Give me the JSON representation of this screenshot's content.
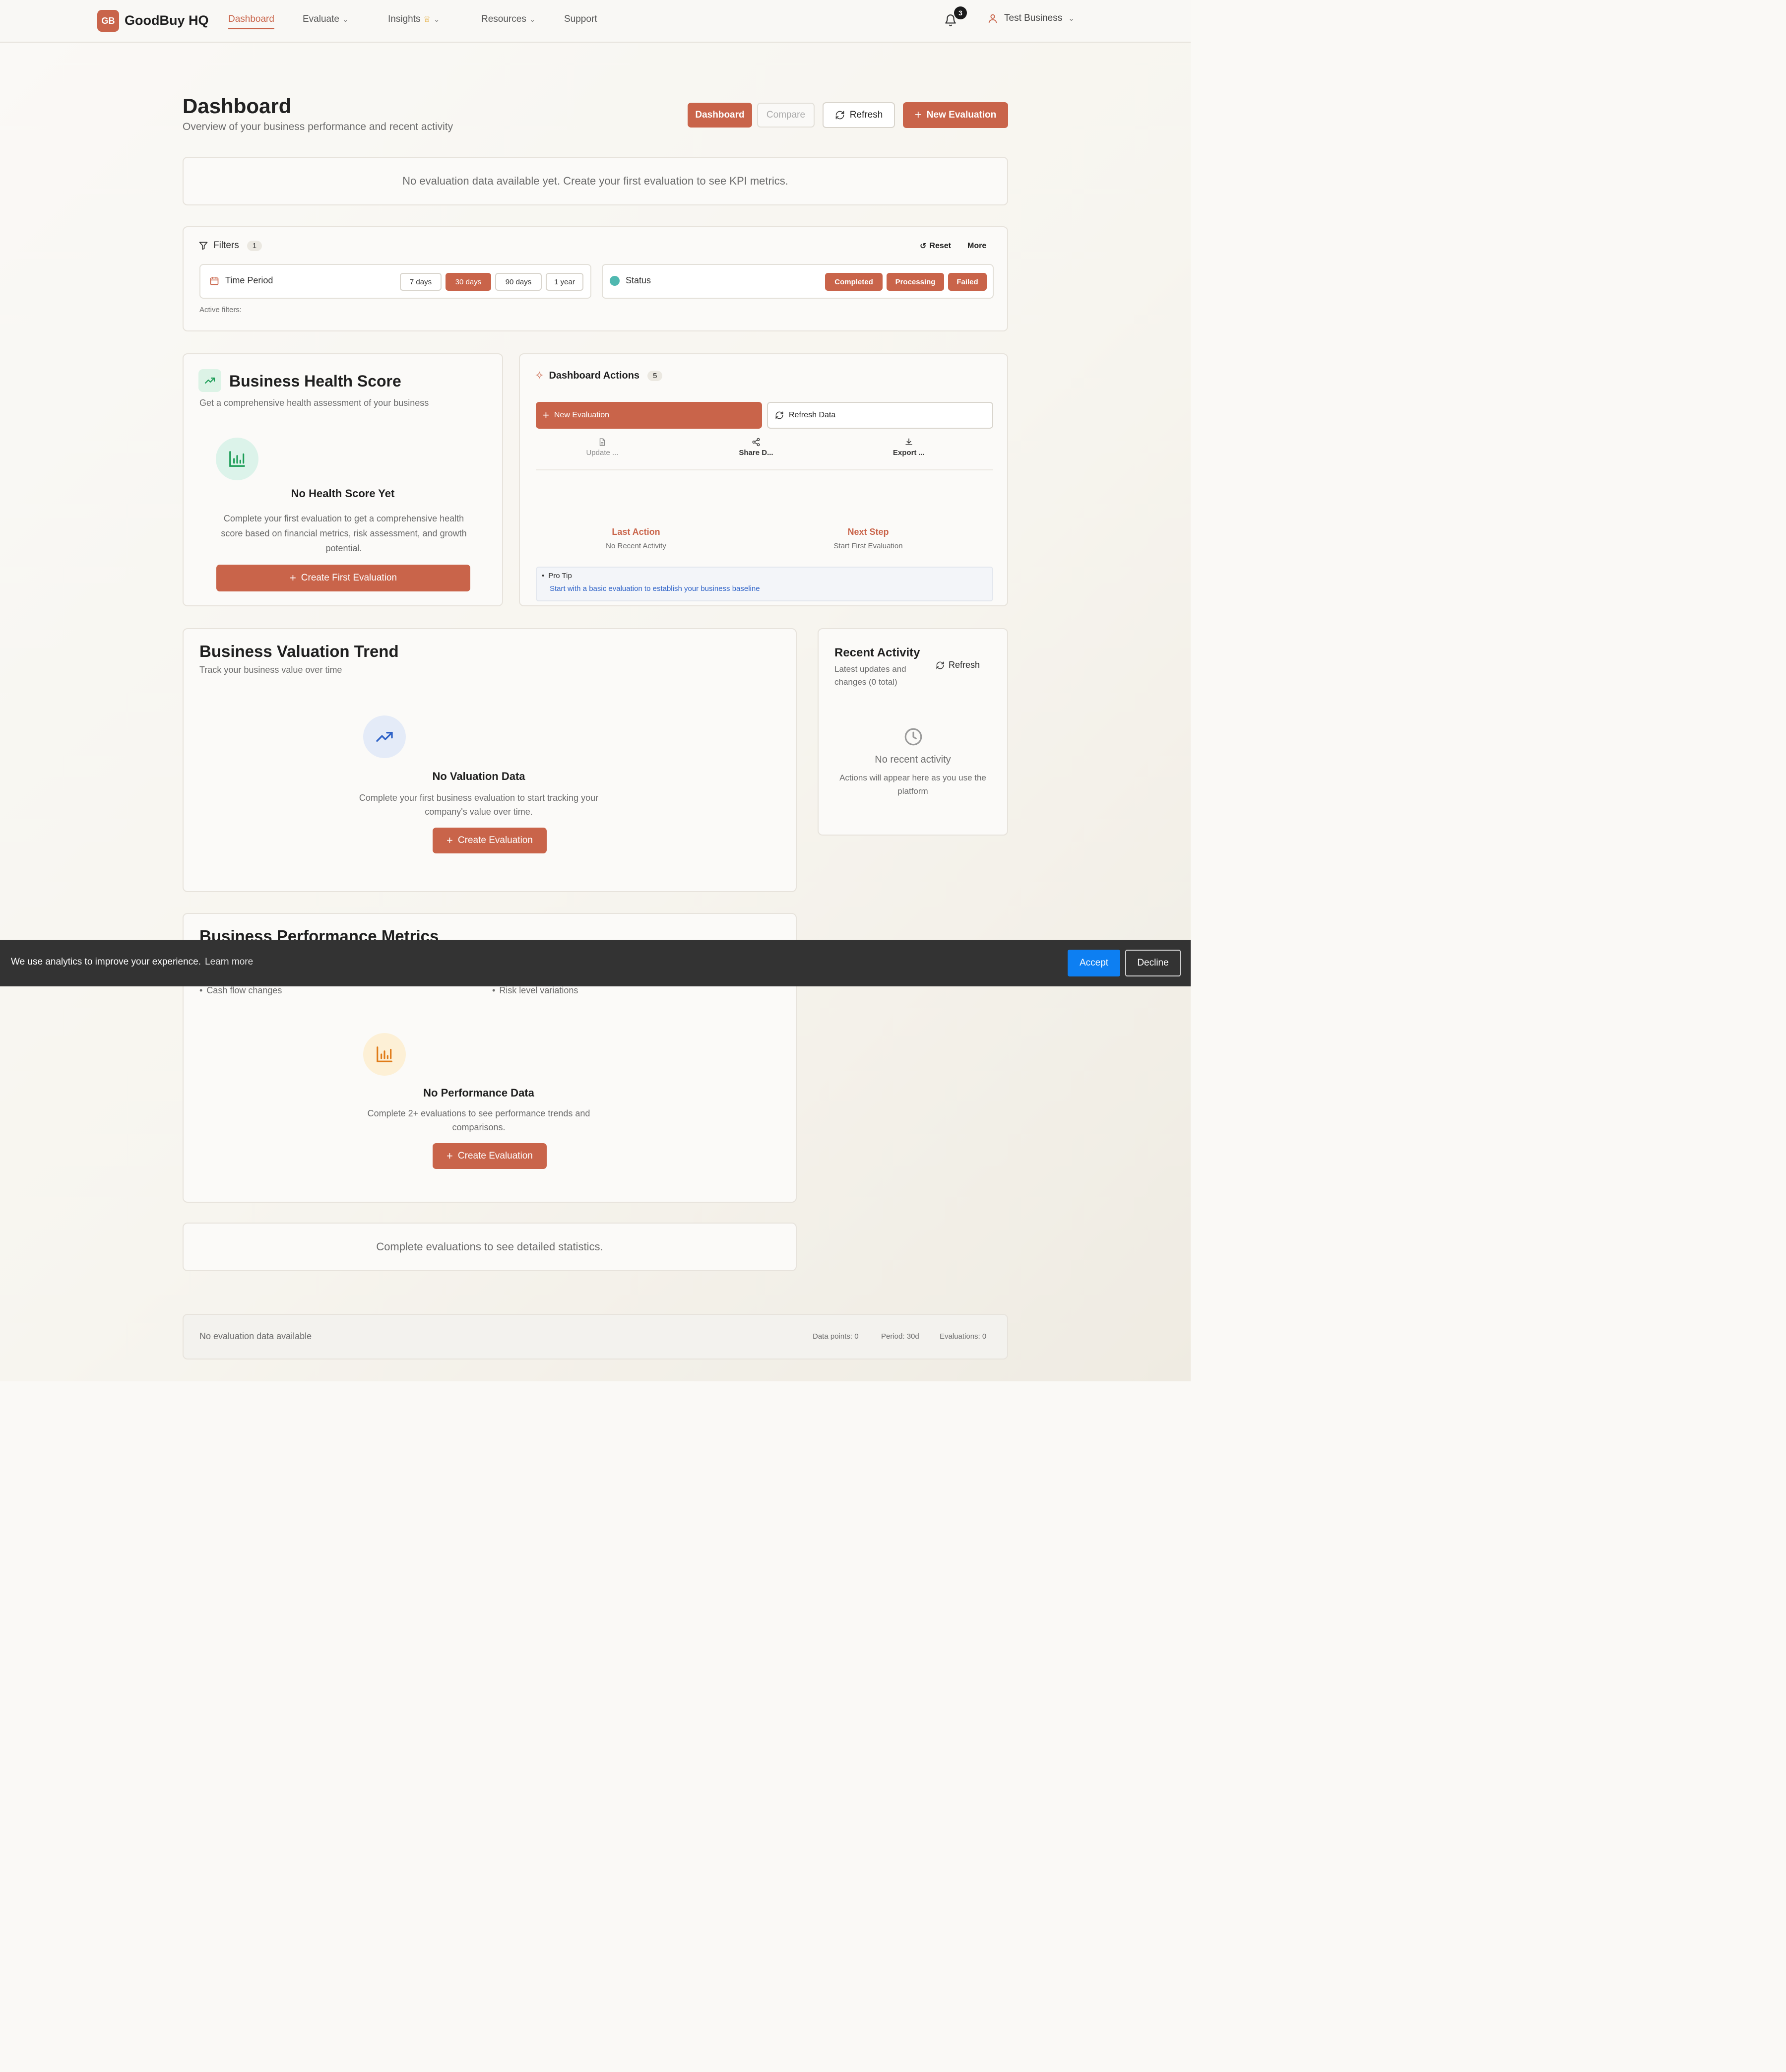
{
  "header": {
    "logo_initials": "GB",
    "brand": "GoodBuy HQ",
    "nav": [
      {
        "label": "Dashboard"
      },
      {
        "label": "Evaluate"
      },
      {
        "label": "Insights"
      },
      {
        "label": "Resources"
      },
      {
        "label": "Support"
      }
    ],
    "insights_badge_icon": "crown-icon",
    "notification_count": "3",
    "user_name": "Test Business"
  },
  "page": {
    "title": "Dashboard",
    "subtitle": "Overview of your business performance and recent activity",
    "view_toggle": [
      "Dashboard",
      "Compare"
    ],
    "refresh_label": "Refresh",
    "new_evaluation_label": "New Evaluation"
  },
  "kpi_notice": "No evaluation data available yet. Create your first evaluation to see KPI metrics.",
  "filters": {
    "title": "Filters",
    "count": "1",
    "reset_label": "Reset",
    "more_label": "More",
    "time_period_label": "Time Period",
    "time_options": [
      "7 days",
      "30 days",
      "90 days",
      "1 year"
    ],
    "time_selected": "30 days",
    "status_label": "Status",
    "status_options": [
      "Completed",
      "Processing",
      "Failed"
    ],
    "active_filters_label": "Active filters:"
  },
  "health": {
    "title": "Business Health Score",
    "subtitle": "Get a comprehensive health assessment of your business",
    "empty_title": "No Health Score Yet",
    "empty_text": "Complete your first evaluation to get a comprehensive health score based on financial metrics, risk assessment, and growth potential.",
    "cta": "Create First Evaluation"
  },
  "actions": {
    "title": "Dashboard Actions",
    "count": "5",
    "new_evaluation": "New Evaluation",
    "refresh_data": "Refresh Data",
    "mini": [
      "Update ...",
      "Share D...",
      "Export ..."
    ],
    "last_action_label": "Last Action",
    "last_action_value": "No Recent Activity",
    "next_step_label": "Next Step",
    "next_step_value": "Start First Evaluation",
    "tip_title": "Pro Tip",
    "tip_text": "Start with a basic evaluation to establish your business baseline"
  },
  "valuation": {
    "title": "Business Valuation Trend",
    "subtitle": "Track your business value over time",
    "empty_title": "No Valuation Data",
    "empty_text": "Complete your first business evaluation to start tracking your company's value over time.",
    "cta": "Create Evaluation"
  },
  "activity": {
    "title": "Recent Activity",
    "subtitle": "Latest updates and changes (0 total)",
    "refresh_label": "Refresh",
    "empty_title": "No recent activity",
    "empty_text": "Actions will appear here as you use the platform"
  },
  "performance": {
    "title": "Business Performance Metrics",
    "bullets": [
      "Cash flow changes",
      "Risk level variations"
    ],
    "empty_title": "No Performance Data",
    "empty_text": "Complete 2+ evaluations to see performance trends and comparisons.",
    "cta": "Create Evaluation"
  },
  "stats_notice": "Complete evaluations to see detailed statistics.",
  "footer_bar": {
    "left": "No evaluation data available",
    "data_points": "Data points: 0",
    "period": "Period: 30d",
    "evaluations": "Evaluations: 0"
  },
  "cookie": {
    "text": "We use analytics to improve your experience.",
    "link": "Learn more",
    "accept": "Accept",
    "decline": "Decline"
  },
  "colors": {
    "accent": "#c9644a",
    "accept_blue": "#0d7ff2",
    "cookie_bg": "#333333",
    "status_dot": "#4fb8b0"
  }
}
